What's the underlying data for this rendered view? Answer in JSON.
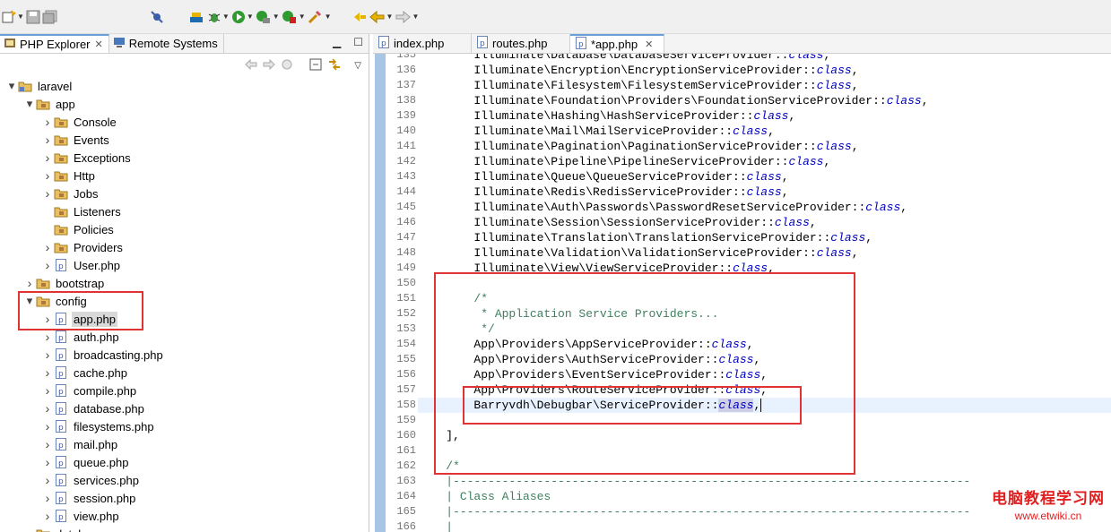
{
  "toolbar": {
    "icons": [
      "new-wizard-icon",
      "save-icon",
      "save-all-icon",
      "skip-breakpoints-icon",
      "build-icon",
      "debug-icon",
      "run-icon",
      "run-coverage-icon",
      "external-tools-icon",
      "search-icon",
      "last-edit-icon",
      "back-icon",
      "forward-icon"
    ]
  },
  "left_panel": {
    "tabs": [
      {
        "label": "PHP Explorer",
        "icon": "php-explorer-icon"
      },
      {
        "label": "Remote Systems",
        "icon": "remote-systems-icon"
      }
    ],
    "tree": [
      {
        "label": "laravel",
        "level": 0,
        "type": "project",
        "expanded": true
      },
      {
        "label": "app",
        "level": 1,
        "type": "package",
        "expanded": true
      },
      {
        "label": "Console",
        "level": 2,
        "type": "package",
        "expanded": false
      },
      {
        "label": "Events",
        "level": 2,
        "type": "package",
        "expanded": false
      },
      {
        "label": "Exceptions",
        "level": 2,
        "type": "package",
        "expanded": false
      },
      {
        "label": "Http",
        "level": 2,
        "type": "package",
        "expanded": false
      },
      {
        "label": "Jobs",
        "level": 2,
        "type": "package",
        "expanded": false
      },
      {
        "label": "Listeners",
        "level": 2,
        "type": "package",
        "leaf": true
      },
      {
        "label": "Policies",
        "level": 2,
        "type": "package",
        "leaf": true
      },
      {
        "label": "Providers",
        "level": 2,
        "type": "package",
        "expanded": false
      },
      {
        "label": "User.php",
        "level": 2,
        "type": "php",
        "expanded": false
      },
      {
        "label": "bootstrap",
        "level": 1,
        "type": "package",
        "expanded": false
      },
      {
        "label": "config",
        "level": 1,
        "type": "package",
        "expanded": true
      },
      {
        "label": "app.php",
        "level": 2,
        "type": "php",
        "expanded": false,
        "selected": true
      },
      {
        "label": "auth.php",
        "level": 2,
        "type": "php",
        "expanded": false
      },
      {
        "label": "broadcasting.php",
        "level": 2,
        "type": "php",
        "expanded": false
      },
      {
        "label": "cache.php",
        "level": 2,
        "type": "php",
        "expanded": false
      },
      {
        "label": "compile.php",
        "level": 2,
        "type": "php",
        "expanded": false
      },
      {
        "label": "database.php",
        "level": 2,
        "type": "php",
        "expanded": false
      },
      {
        "label": "filesystems.php",
        "level": 2,
        "type": "php",
        "expanded": false
      },
      {
        "label": "mail.php",
        "level": 2,
        "type": "php",
        "expanded": false
      },
      {
        "label": "queue.php",
        "level": 2,
        "type": "php",
        "expanded": false
      },
      {
        "label": "services.php",
        "level": 2,
        "type": "php",
        "expanded": false
      },
      {
        "label": "session.php",
        "level": 2,
        "type": "php",
        "expanded": false
      },
      {
        "label": "view.php",
        "level": 2,
        "type": "php",
        "expanded": false
      },
      {
        "label": "database",
        "level": 1,
        "type": "package",
        "expanded": false
      }
    ]
  },
  "editor": {
    "tabs": [
      {
        "label": "index.php",
        "active": false
      },
      {
        "label": "routes.php",
        "active": false
      },
      {
        "label": "*app.php",
        "active": true
      }
    ],
    "current_line": "158",
    "lines": [
      {
        "n": "135",
        "parts": [
          {
            "t": "        Illuminate\\Database\\DatabaseServiceProvider::"
          },
          {
            "t": "class",
            "k": "kw"
          },
          {
            "t": ","
          }
        ]
      },
      {
        "n": "136",
        "parts": [
          {
            "t": "        Illuminate\\Encryption\\EncryptionServiceProvider::"
          },
          {
            "t": "class",
            "k": "kw"
          },
          {
            "t": ","
          }
        ]
      },
      {
        "n": "137",
        "parts": [
          {
            "t": "        Illuminate\\Filesystem\\FilesystemServiceProvider::"
          },
          {
            "t": "class",
            "k": "kw"
          },
          {
            "t": ","
          }
        ]
      },
      {
        "n": "138",
        "parts": [
          {
            "t": "        Illuminate\\Foundation\\Providers\\FoundationServiceProvider::"
          },
          {
            "t": "class",
            "k": "kw"
          },
          {
            "t": ","
          }
        ]
      },
      {
        "n": "139",
        "parts": [
          {
            "t": "        Illuminate\\Hashing\\HashServiceProvider::"
          },
          {
            "t": "class",
            "k": "kw"
          },
          {
            "t": ","
          }
        ]
      },
      {
        "n": "140",
        "parts": [
          {
            "t": "        Illuminate\\Mail\\MailServiceProvider::"
          },
          {
            "t": "class",
            "k": "kw"
          },
          {
            "t": ","
          }
        ]
      },
      {
        "n": "141",
        "parts": [
          {
            "t": "        Illuminate\\Pagination\\PaginationServiceProvider::"
          },
          {
            "t": "class",
            "k": "kw"
          },
          {
            "t": ","
          }
        ]
      },
      {
        "n": "142",
        "parts": [
          {
            "t": "        Illuminate\\Pipeline\\PipelineServiceProvider::"
          },
          {
            "t": "class",
            "k": "kw"
          },
          {
            "t": ","
          }
        ]
      },
      {
        "n": "143",
        "parts": [
          {
            "t": "        Illuminate\\Queue\\QueueServiceProvider::"
          },
          {
            "t": "class",
            "k": "kw"
          },
          {
            "t": ","
          }
        ]
      },
      {
        "n": "144",
        "parts": [
          {
            "t": "        Illuminate\\Redis\\RedisServiceProvider::"
          },
          {
            "t": "class",
            "k": "kw"
          },
          {
            "t": ","
          }
        ]
      },
      {
        "n": "145",
        "parts": [
          {
            "t": "        Illuminate\\Auth\\Passwords\\PasswordResetServiceProvider::"
          },
          {
            "t": "class",
            "k": "kw"
          },
          {
            "t": ","
          }
        ]
      },
      {
        "n": "146",
        "parts": [
          {
            "t": "        Illuminate\\Session\\SessionServiceProvider::"
          },
          {
            "t": "class",
            "k": "kw"
          },
          {
            "t": ","
          }
        ]
      },
      {
        "n": "147",
        "parts": [
          {
            "t": "        Illuminate\\Translation\\TranslationServiceProvider::"
          },
          {
            "t": "class",
            "k": "kw"
          },
          {
            "t": ","
          }
        ]
      },
      {
        "n": "148",
        "parts": [
          {
            "t": "        Illuminate\\Validation\\ValidationServiceProvider::"
          },
          {
            "t": "class",
            "k": "kw"
          },
          {
            "t": ","
          }
        ]
      },
      {
        "n": "149",
        "parts": [
          {
            "t": "        Illuminate\\View\\ViewServiceProvider::"
          },
          {
            "t": "class",
            "k": "kw"
          },
          {
            "t": ","
          }
        ]
      },
      {
        "n": "150",
        "parts": [
          {
            "t": ""
          }
        ]
      },
      {
        "n": "151",
        "parts": [
          {
            "t": "        "
          },
          {
            "t": "/*",
            "k": "cm"
          }
        ]
      },
      {
        "n": "152",
        "parts": [
          {
            "t": "         "
          },
          {
            "t": "* Application Service Providers...",
            "k": "cm"
          }
        ]
      },
      {
        "n": "153",
        "parts": [
          {
            "t": "         "
          },
          {
            "t": "*/",
            "k": "cm"
          }
        ]
      },
      {
        "n": "154",
        "parts": [
          {
            "t": "        App\\Providers\\AppServiceProvider::"
          },
          {
            "t": "class",
            "k": "kw"
          },
          {
            "t": ","
          }
        ]
      },
      {
        "n": "155",
        "parts": [
          {
            "t": "        App\\Providers\\AuthServiceProvider::"
          },
          {
            "t": "class",
            "k": "kw"
          },
          {
            "t": ","
          }
        ]
      },
      {
        "n": "156",
        "parts": [
          {
            "t": "        App\\Providers\\EventServiceProvider::"
          },
          {
            "t": "class",
            "k": "kw"
          },
          {
            "t": ","
          }
        ]
      },
      {
        "n": "157",
        "parts": [
          {
            "t": "        App\\Providers\\RouteServiceProvider::"
          },
          {
            "t": "class",
            "k": "kw"
          },
          {
            "t": ","
          }
        ]
      },
      {
        "n": "158",
        "parts": [
          {
            "t": "        Barryvdh\\Debugbar\\ServiceProvider::"
          },
          {
            "t": "class",
            "k": "kw hl"
          },
          {
            "t": ","
          },
          {
            "t": "",
            "k": "caret"
          }
        ]
      },
      {
        "n": "159",
        "parts": [
          {
            "t": ""
          }
        ]
      },
      {
        "n": "160",
        "parts": [
          {
            "t": "    ],"
          }
        ]
      },
      {
        "n": "161",
        "parts": [
          {
            "t": ""
          }
        ]
      },
      {
        "n": "162",
        "parts": [
          {
            "t": "    "
          },
          {
            "t": "/*",
            "k": "cm"
          }
        ]
      },
      {
        "n": "163",
        "parts": [
          {
            "t": "    "
          },
          {
            "t": "|--------------------------------------------------------------------------",
            "k": "cm"
          }
        ]
      },
      {
        "n": "164",
        "parts": [
          {
            "t": "    "
          },
          {
            "t": "| Class Aliases",
            "k": "cm"
          }
        ]
      },
      {
        "n": "165",
        "parts": [
          {
            "t": "    "
          },
          {
            "t": "|--------------------------------------------------------------------------",
            "k": "cm"
          }
        ]
      },
      {
        "n": "166",
        "parts": [
          {
            "t": "    "
          },
          {
            "t": "|",
            "k": "cm"
          }
        ]
      }
    ]
  },
  "watermark": {
    "line1": "电脑教程学习网",
    "line2": "www.etwiki.cn"
  },
  "colors": {
    "annotation_red": "#e03434",
    "keyword_blue": "#0000c0",
    "comment_green": "#3f7f5f",
    "tab_accent": "#6aa0d8"
  }
}
